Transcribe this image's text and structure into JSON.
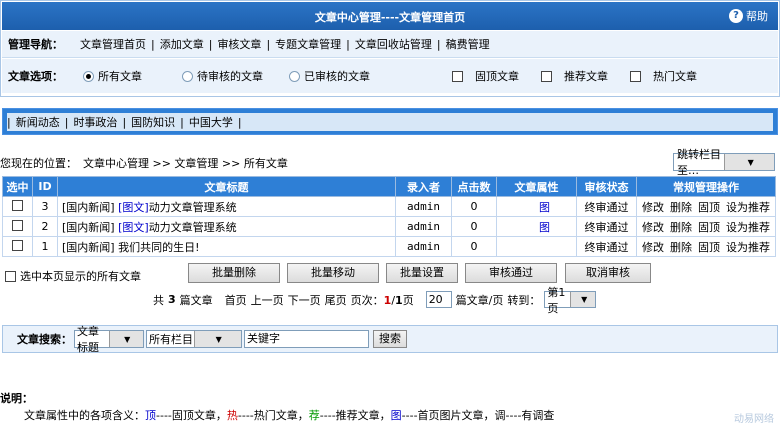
{
  "header": {
    "title": "文章中心管理----文章管理首页",
    "help": "帮助"
  },
  "nav": {
    "label": "管理导航：",
    "links": [
      "文章管理首页",
      "添加文章",
      "审核文章",
      "专题文章管理",
      "文章回收站管理",
      "稿费管理"
    ]
  },
  "options": {
    "label": "文章选项：",
    "radios": [
      "所有文章",
      "待审核的文章",
      "已审核的文章"
    ],
    "selected_radio": "所有文章",
    "checks": [
      "固顶文章",
      "推荐文章",
      "热门文章"
    ]
  },
  "categories": [
    "新闻动态",
    "时事政治",
    "国防知识",
    "中国大学"
  ],
  "location": {
    "label": "您现在的位置：",
    "path": "文章中心管理 >> 文章管理 >> 所有文章",
    "jump_placeholder": "跳转栏目至…"
  },
  "table": {
    "headers": [
      "选中",
      "ID",
      "文章标题",
      "录入者",
      "点击数",
      "文章属性",
      "审核状态",
      "常规管理操作"
    ],
    "rows": [
      {
        "id": "3",
        "prefix": "[国内新闻]",
        "tag": "[图文]",
        "title": "动力文章管理系统",
        "author": "admin",
        "hits": "0",
        "attr": "图",
        "status": "终审通过",
        "ops": [
          "修改",
          "删除",
          "固顶",
          "设为推荐"
        ]
      },
      {
        "id": "2",
        "prefix": "[国内新闻]",
        "tag": "[图文]",
        "title": "动力文章管理系统",
        "author": "admin",
        "hits": "0",
        "attr": "图",
        "status": "终审通过",
        "ops": [
          "修改",
          "删除",
          "固顶",
          "设为推荐"
        ]
      },
      {
        "id": "1",
        "prefix": "[国内新闻]",
        "tag": "",
        "title": "我们共同的生日!",
        "author": "admin",
        "hits": "0",
        "attr": "",
        "status": "终审通过",
        "ops": [
          "修改",
          "删除",
          "固顶",
          "设为推荐"
        ]
      }
    ]
  },
  "bulk": {
    "select_all": "选中本页显示的所有文章",
    "buttons": [
      "批量删除",
      "批量移动",
      "批量设置",
      "审核通过",
      "取消审核"
    ]
  },
  "pager": {
    "total_prefix": "共",
    "total": "3",
    "total_suffix": "篇文章",
    "first": "首页",
    "prev": "上一页",
    "next": "下一页",
    "last": "尾页",
    "pages_label": "页次：",
    "page_current": "1",
    "page_sep": "/",
    "page_total": "1",
    "page_unit": "页",
    "per_page": "20",
    "per_page_label": "篇文章/页",
    "goto_label": "转到：",
    "goto_value": "第1页"
  },
  "search": {
    "label": "文章搜索：",
    "field": "文章标题",
    "column": "所有栏目",
    "keyword": "关键字",
    "button": "搜索"
  },
  "note": {
    "title": "说明：",
    "intro": "文章属性中的各项含义：",
    "k1": "顶",
    "d1": "----固顶文章，",
    "k2": "热",
    "d2": "----热门文章，",
    "k3": "荐",
    "d3": "----推荐文章，",
    "k4": "图",
    "d4": "----首页图片文章，调----有调查"
  },
  "watermark": "动易网络",
  "colors": {
    "header_blue": "#1d5fad",
    "table_header": "#2e7fd6",
    "panel_bg": "#eaf2fb",
    "red": "#cc0000",
    "green": "#009900"
  }
}
